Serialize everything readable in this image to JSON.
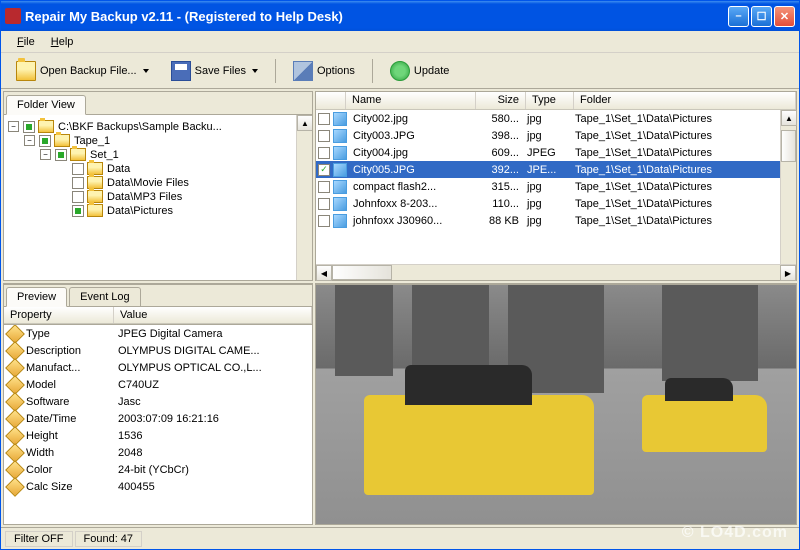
{
  "titlebar": {
    "text": "Repair My Backup v2.11  -  (Registered to Help Desk)"
  },
  "menu": {
    "file": "File",
    "help": "Help",
    "file_u": "F",
    "help_u": "H"
  },
  "toolbar": {
    "open": "Open Backup File...",
    "save": "Save Files",
    "options": "Options",
    "update": "Update"
  },
  "tabs": {
    "folder_view": "Folder View",
    "preview": "Preview",
    "event_log": "Event Log"
  },
  "tree": {
    "root": "C:\\BKF Backups\\Sample Backu...",
    "items": [
      "Tape_1",
      "Set_1",
      "Data",
      "Data\\Movie Files",
      "Data\\MP3 Files",
      "Data\\Pictures"
    ]
  },
  "list": {
    "headers": {
      "name": "Name",
      "size": "Size",
      "type": "Type",
      "folder": "Folder"
    },
    "rows": [
      {
        "name": "City002.jpg",
        "size": "580...",
        "type": "jpg",
        "folder": "Tape_1\\Set_1\\Data\\Pictures",
        "sel": false,
        "checked": false
      },
      {
        "name": "City003.JPG",
        "size": "398...",
        "type": "jpg",
        "folder": "Tape_1\\Set_1\\Data\\Pictures",
        "sel": false,
        "checked": false
      },
      {
        "name": "City004.jpg",
        "size": "609...",
        "type": "JPEG",
        "folder": "Tape_1\\Set_1\\Data\\Pictures",
        "sel": false,
        "checked": false
      },
      {
        "name": "City005.JPG",
        "size": "392...",
        "type": "JPE...",
        "folder": "Tape_1\\Set_1\\Data\\Pictures",
        "sel": true,
        "checked": true
      },
      {
        "name": "compact flash2...",
        "size": "315...",
        "type": "jpg",
        "folder": "Tape_1\\Set_1\\Data\\Pictures",
        "sel": false,
        "checked": false
      },
      {
        "name": "Johnfoxx 8-203...",
        "size": "110...",
        "type": "jpg",
        "folder": "Tape_1\\Set_1\\Data\\Pictures",
        "sel": false,
        "checked": false
      },
      {
        "name": "johnfoxx J30960...",
        "size": "88 KB",
        "type": "jpg",
        "folder": "Tape_1\\Set_1\\Data\\Pictures",
        "sel": false,
        "checked": false
      }
    ]
  },
  "props": {
    "headers": {
      "property": "Property",
      "value": "Value"
    },
    "rows": [
      {
        "p": "Type",
        "v": "JPEG Digital Camera"
      },
      {
        "p": "Description",
        "v": "OLYMPUS DIGITAL CAME..."
      },
      {
        "p": "Manufact...",
        "v": "OLYMPUS OPTICAL CO.,L..."
      },
      {
        "p": "Model",
        "v": "C740UZ"
      },
      {
        "p": "Software",
        "v": "Jasc"
      },
      {
        "p": "Date/Time",
        "v": "2003:07:09 16:21:16"
      },
      {
        "p": "Height",
        "v": "1536"
      },
      {
        "p": "Width",
        "v": "2048"
      },
      {
        "p": "Color",
        "v": "24-bit (YCbCr)"
      },
      {
        "p": "Calc Size",
        "v": "400455"
      }
    ]
  },
  "status": {
    "filter": "Filter OFF",
    "found": "Found:  47"
  },
  "watermark": "© LO4D.com"
}
